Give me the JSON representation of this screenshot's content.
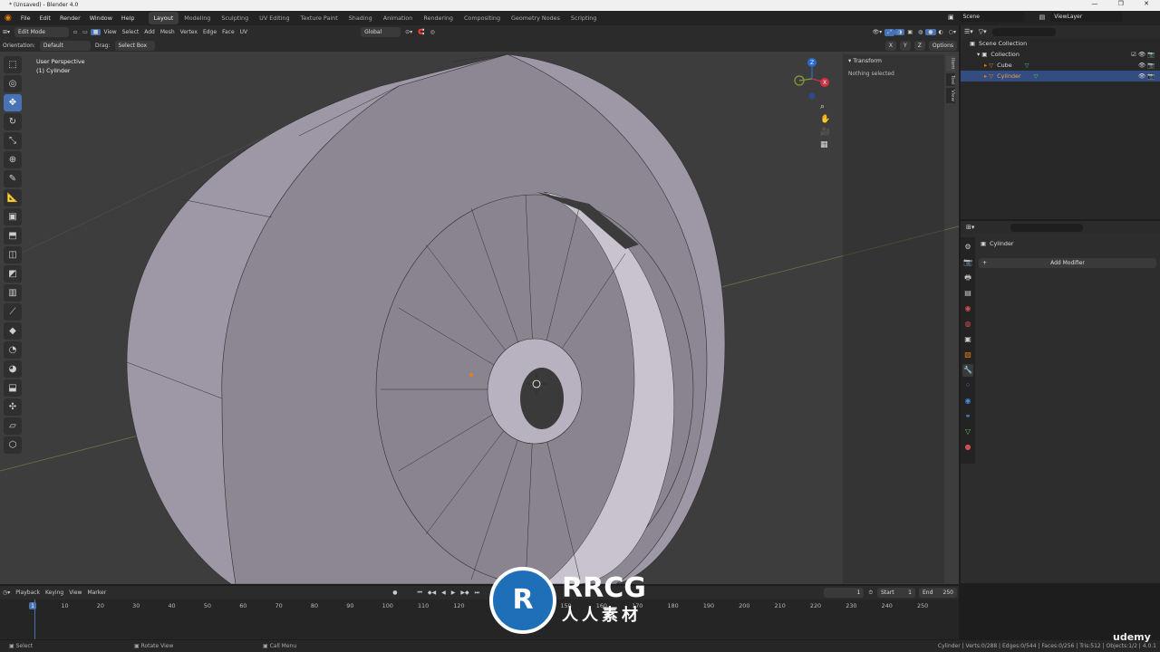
{
  "window": {
    "title": "* (Unsaved) - Blender 4.0",
    "controls": "— ❐ ✕"
  },
  "menu": [
    "File",
    "Edit",
    "Render",
    "Window",
    "Help"
  ],
  "workspaces": [
    "Layout",
    "Modeling",
    "Sculpting",
    "UV Editing",
    "Texture Paint",
    "Shading",
    "Animation",
    "Rendering",
    "Compositing",
    "Geometry Nodes",
    "Scripting"
  ],
  "scene": {
    "label": "Scene",
    "viewlayer": "ViewLayer"
  },
  "header": {
    "mode": "Edit Mode",
    "menus": [
      "View",
      "Select",
      "Add",
      "Mesh",
      "Vertex",
      "Edge",
      "Face",
      "UV"
    ],
    "transform_orientation": "Global",
    "orientation_label": "Orientation:",
    "orientation_value": "Default",
    "drag_label": "Drag:",
    "drag_value": "Select Box",
    "options": "Options",
    "axes": [
      "X",
      "Y",
      "Z"
    ]
  },
  "viewport": {
    "perspective": "User Perspective",
    "object": "(1) Cylinder"
  },
  "npanel": {
    "section": "Transform",
    "status": "Nothing selected",
    "tabs": [
      "Item",
      "Tool",
      "View"
    ]
  },
  "outliner": {
    "scene_collection": "Scene Collection",
    "collection": "Collection",
    "items": [
      {
        "name": "Cube",
        "selected": false
      },
      {
        "name": "Cylinder",
        "selected": true
      }
    ]
  },
  "properties": {
    "object": "Cylinder",
    "add_modifier": "Add Modifier"
  },
  "timeline": {
    "menus": [
      "Playback",
      "Keying",
      "View",
      "Marker"
    ],
    "current_frame": "1",
    "start_label": "Start",
    "start": "1",
    "end_label": "End",
    "end": "250",
    "ticks": [
      "1",
      "10",
      "20",
      "30",
      "40",
      "50",
      "60",
      "70",
      "80",
      "90",
      "100",
      "110",
      "120",
      "130",
      "140",
      "150",
      "160",
      "170",
      "180",
      "190",
      "200",
      "210",
      "220",
      "230",
      "240",
      "250"
    ]
  },
  "status": {
    "left": [
      "Select",
      "Rotate View",
      "Call Menu"
    ],
    "stats": "Cylinder | Verts:0/288 | Edges:0/544 | Faces:0/256 | Tris:512 | Objects:1/2 | 4.0.1"
  },
  "watermark": {
    "brand": "RRCG",
    "sub": "人人素材",
    "udemy": "udemy"
  },
  "colors": {
    "accent": "#4772b3",
    "mesh": "#a59dab",
    "grid_y": "#8a9a3a",
    "grid_x": "#9a4a4a",
    "selected_row": "#334d80"
  }
}
